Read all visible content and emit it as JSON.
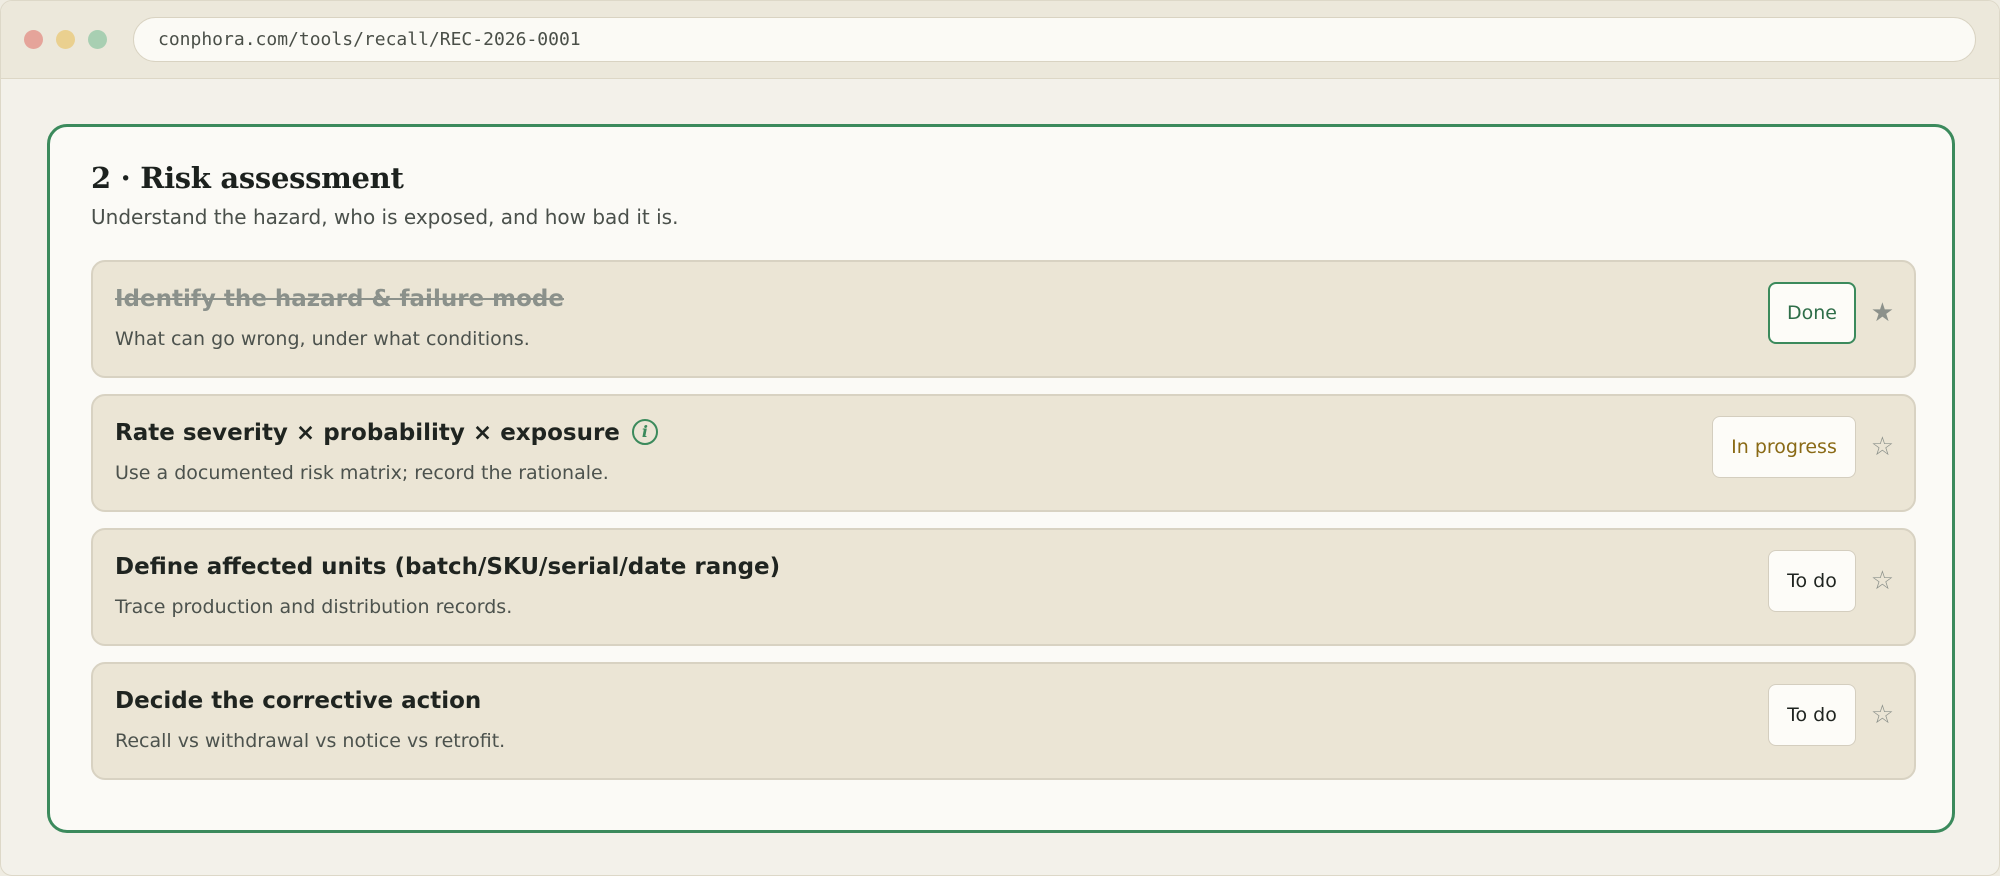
{
  "browser": {
    "url": "conphora.com/tools/recall/REC-2026-0001"
  },
  "section": {
    "title": "2 · Risk assessment",
    "subtitle": "Understand the hazard, who is exposed, and how bad it is."
  },
  "tasks": [
    {
      "title": "Identify the hazard & failure mode",
      "description": "What can go wrong, under what conditions.",
      "status": "Done",
      "star": "★"
    },
    {
      "title": "Rate severity × probability × exposure",
      "description": "Use a documented risk matrix; record the rationale.",
      "status": "In progress",
      "star": "☆",
      "info_icon": "i"
    },
    {
      "title": "Define affected units (batch/SKU/serial/date range)",
      "description": "Trace production and distribution records.",
      "status": "To do",
      "star": "☆"
    },
    {
      "title": "Decide the corrective action",
      "description": "Recall vs withdrawal vs notice vs retrofit.",
      "status": "To do",
      "star": "☆"
    }
  ],
  "colors": {
    "accent": "#3b8a5c",
    "in_progress": "#8a6a16",
    "card_bg": "#ebe5d5"
  }
}
